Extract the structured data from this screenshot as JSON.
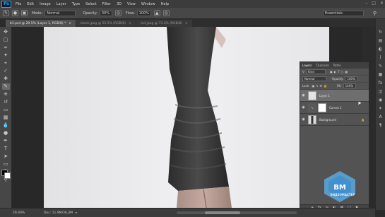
{
  "app": {
    "logo": "Ps"
  },
  "menu": [
    "File",
    "Edit",
    "Image",
    "Layer",
    "Type",
    "Select",
    "Filter",
    "3D",
    "View",
    "Window",
    "Help"
  ],
  "options": {
    "mode_label": "Mode:",
    "mode_value": "Normal",
    "opacity_label": "Opacity:",
    "opacity_value": "30%",
    "flow_label": "Flow:",
    "flow_value": "100%",
    "workspace": "Essentials"
  },
  "tabs": [
    {
      "label": "b1.psd @ 29.5% (Layer 1, RGB/8) *",
      "active": true
    },
    {
      "label": "black.jpeg @ 25.5% (RGB/8)",
      "active": false
    },
    {
      "label": "red.jpeg @ 73.3% (RGB/8)",
      "active": false
    }
  ],
  "layers_panel": {
    "tabs": [
      "Layers",
      "Channels",
      "Paths"
    ],
    "kind": "Kind",
    "blend": "Normal",
    "opacity_label": "Opacity:",
    "opacity_value": "100%",
    "lock_label": "Lock:",
    "fill_label": "Fill:",
    "fill_value": "100%",
    "layers": [
      {
        "name": "Layer 1",
        "selected": true
      },
      {
        "name": "Curves 1",
        "selected": false
      },
      {
        "name": "Background",
        "selected": false
      }
    ]
  },
  "status": {
    "zoom": "29.49%",
    "doc": "Doc: 11,9M/36,3M"
  },
  "watermark": {
    "text": "ВИДЕОМАСТЕР"
  }
}
